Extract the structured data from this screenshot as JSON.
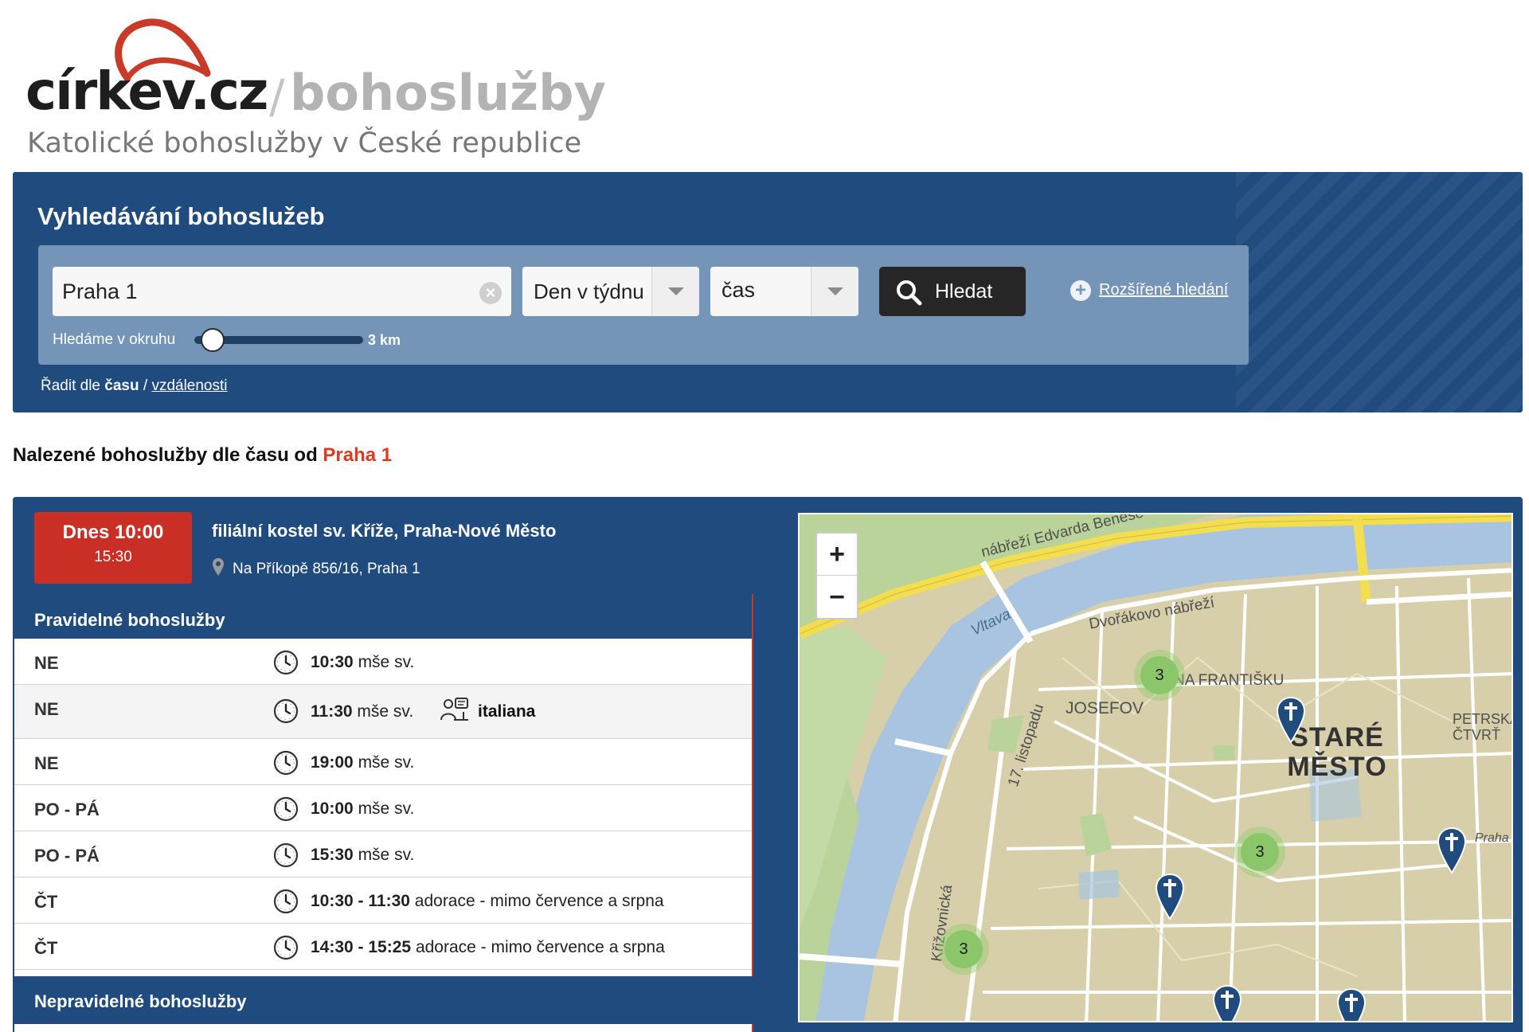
{
  "header": {
    "logo_main": "církev.cz",
    "logo_slash": "/",
    "logo_section": "bohoslužby",
    "tagline": "Katolické bohoslužby v České republice"
  },
  "search": {
    "title": "Vyhledávání bohoslužeb",
    "place_value": "Praha 1",
    "day_select": "Den v týdnu",
    "time_select": "čas",
    "search_button": "Hledat",
    "advanced_link": "Rozšířené hledání",
    "radius_label": "Hledáme v okruhu",
    "radius_value": "3 km",
    "radius_fraction": 0.05,
    "sort_prefix": "Řadit dle",
    "sort_time": "času",
    "sort_separator": "/",
    "sort_distance": "vzdálenosti"
  },
  "results": {
    "title_prefix": "Nalezené bohoslužby dle času od",
    "title_place": "Praha 1"
  },
  "result": {
    "time_main": "Dnes 10:00",
    "time_sub": "15:30",
    "church_name": "filiální kostel sv. Kříže, Praha-Nové Město",
    "address": "Na Příkopě 856/16, Praha 1",
    "regular_heading": "Pravidelné bohoslužby",
    "irregular_heading": "Nepravidelné bohoslužby",
    "schedule": [
      {
        "day": "NE",
        "time": "10:30",
        "desc": "mše sv.",
        "lang": ""
      },
      {
        "day": "NE",
        "time": "11:30",
        "desc": "mše sv.",
        "lang": "italiana"
      },
      {
        "day": "NE",
        "time": "19:00",
        "desc": "mše sv.",
        "lang": ""
      },
      {
        "day": "PO - PÁ",
        "time": "10:00",
        "desc": "mše sv.",
        "lang": ""
      },
      {
        "day": "PO - PÁ",
        "time": "15:30",
        "desc": "mše sv.",
        "lang": ""
      },
      {
        "day": "ČT",
        "time": "10:30 - 11:30",
        "desc": "adorace - mimo července a srpna",
        "lang": ""
      },
      {
        "day": "ČT",
        "time": "14:30 - 15:25",
        "desc": "adorace - mimo července a srpna",
        "lang": ""
      }
    ]
  },
  "map": {
    "zoom_in": "+",
    "zoom_out": "−",
    "labels": {
      "nabrezi_benese": "nábřeží Edvarda Beneše",
      "dvorakovo": "Dvořákovo nábřeží",
      "vltava": "Vltava",
      "na_frantisku": "NA FRANTIŠKU",
      "josefov": "JOSEFOV",
      "listopadu": "17. listopadu",
      "krizovnicka": "Křižovnická",
      "petrska": "PETRSKÁ ČTVRŤ",
      "praha": "Praha",
      "stare_mesto": "STARÉ MĚSTO"
    },
    "clusters": [
      "3",
      "3",
      "3"
    ],
    "colors": {
      "land": "#d7cfa9",
      "water": "#a8c4e0",
      "park": "#b9d39a",
      "road_major": "#f2de4e",
      "cluster": "#8cc66a",
      "pin": "#1f4b7e"
    }
  },
  "colors": {
    "brand_blue": "#1f4b7e",
    "form_box": "#7494b8",
    "accent_red": "#c92f24",
    "place_red": "#d93c23"
  }
}
